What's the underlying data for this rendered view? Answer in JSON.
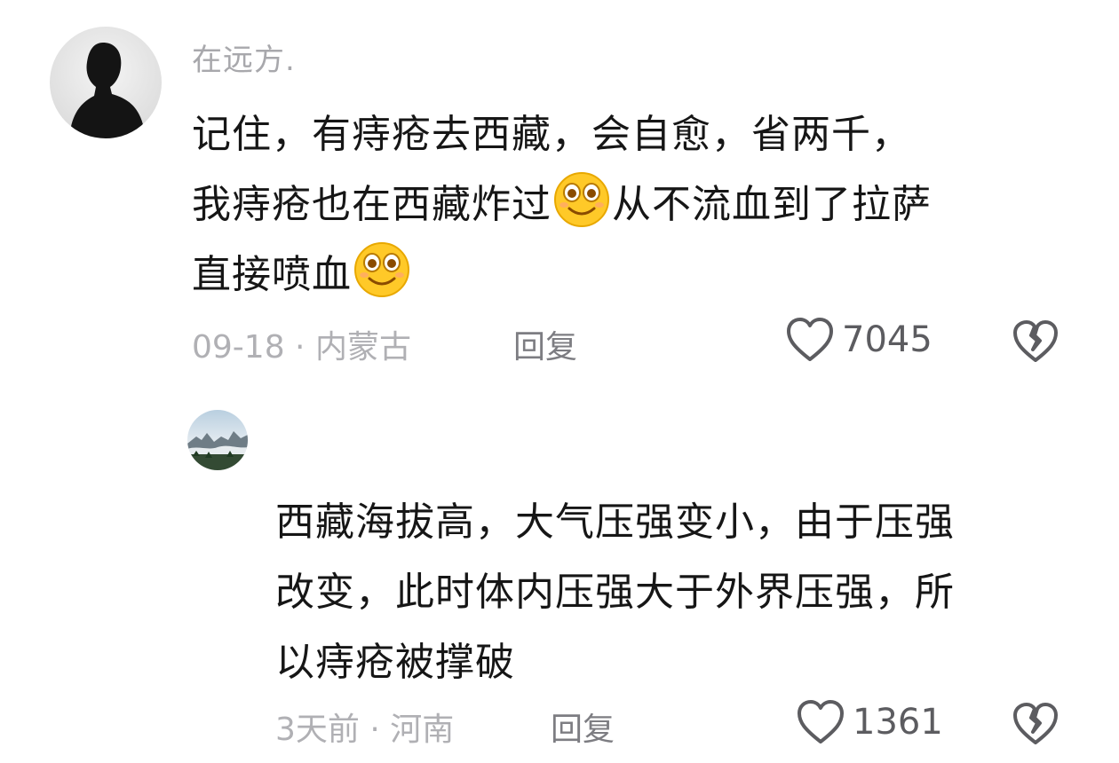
{
  "comments": [
    {
      "username": "在远方.",
      "avatar": "person-silhouette-avatar",
      "lines": [
        {
          "text_a": "记住，有痔疮去西藏，会自愈，省两千，",
          "emoji": "",
          "text_b": ""
        },
        {
          "text_a": "我痔疮也在西藏炸过",
          "emoji": "smile-emoji",
          "text_b": "从不流血到了拉萨"
        },
        {
          "text_a": "直接喷血",
          "emoji": "smile-emoji",
          "text_b": ""
        }
      ],
      "meta": "09-18 · 内蒙古",
      "reply_label": "回复",
      "likes": "7045",
      "like_icon": "heart-outline-icon",
      "dislike_icon": "broken-heart-icon"
    },
    {
      "avatar": "mountain-landscape-avatar",
      "lines": [
        {
          "text_a": "西藏海拔高，大气压强变小，由于压强"
        },
        {
          "text_a": "改变，此时体内压强大于外界压强，所"
        },
        {
          "text_a": "以痔疮被撑破"
        }
      ],
      "meta": "3天前 · 河南",
      "reply_label": "回复",
      "likes": "1361",
      "like_icon": "heart-outline-icon",
      "dislike_icon": "broken-heart-icon"
    }
  ],
  "colors": {
    "text": "#161616",
    "muted": "#b0b0b4",
    "reply": "#7d7d82",
    "emoji_face": "#ffc928"
  }
}
